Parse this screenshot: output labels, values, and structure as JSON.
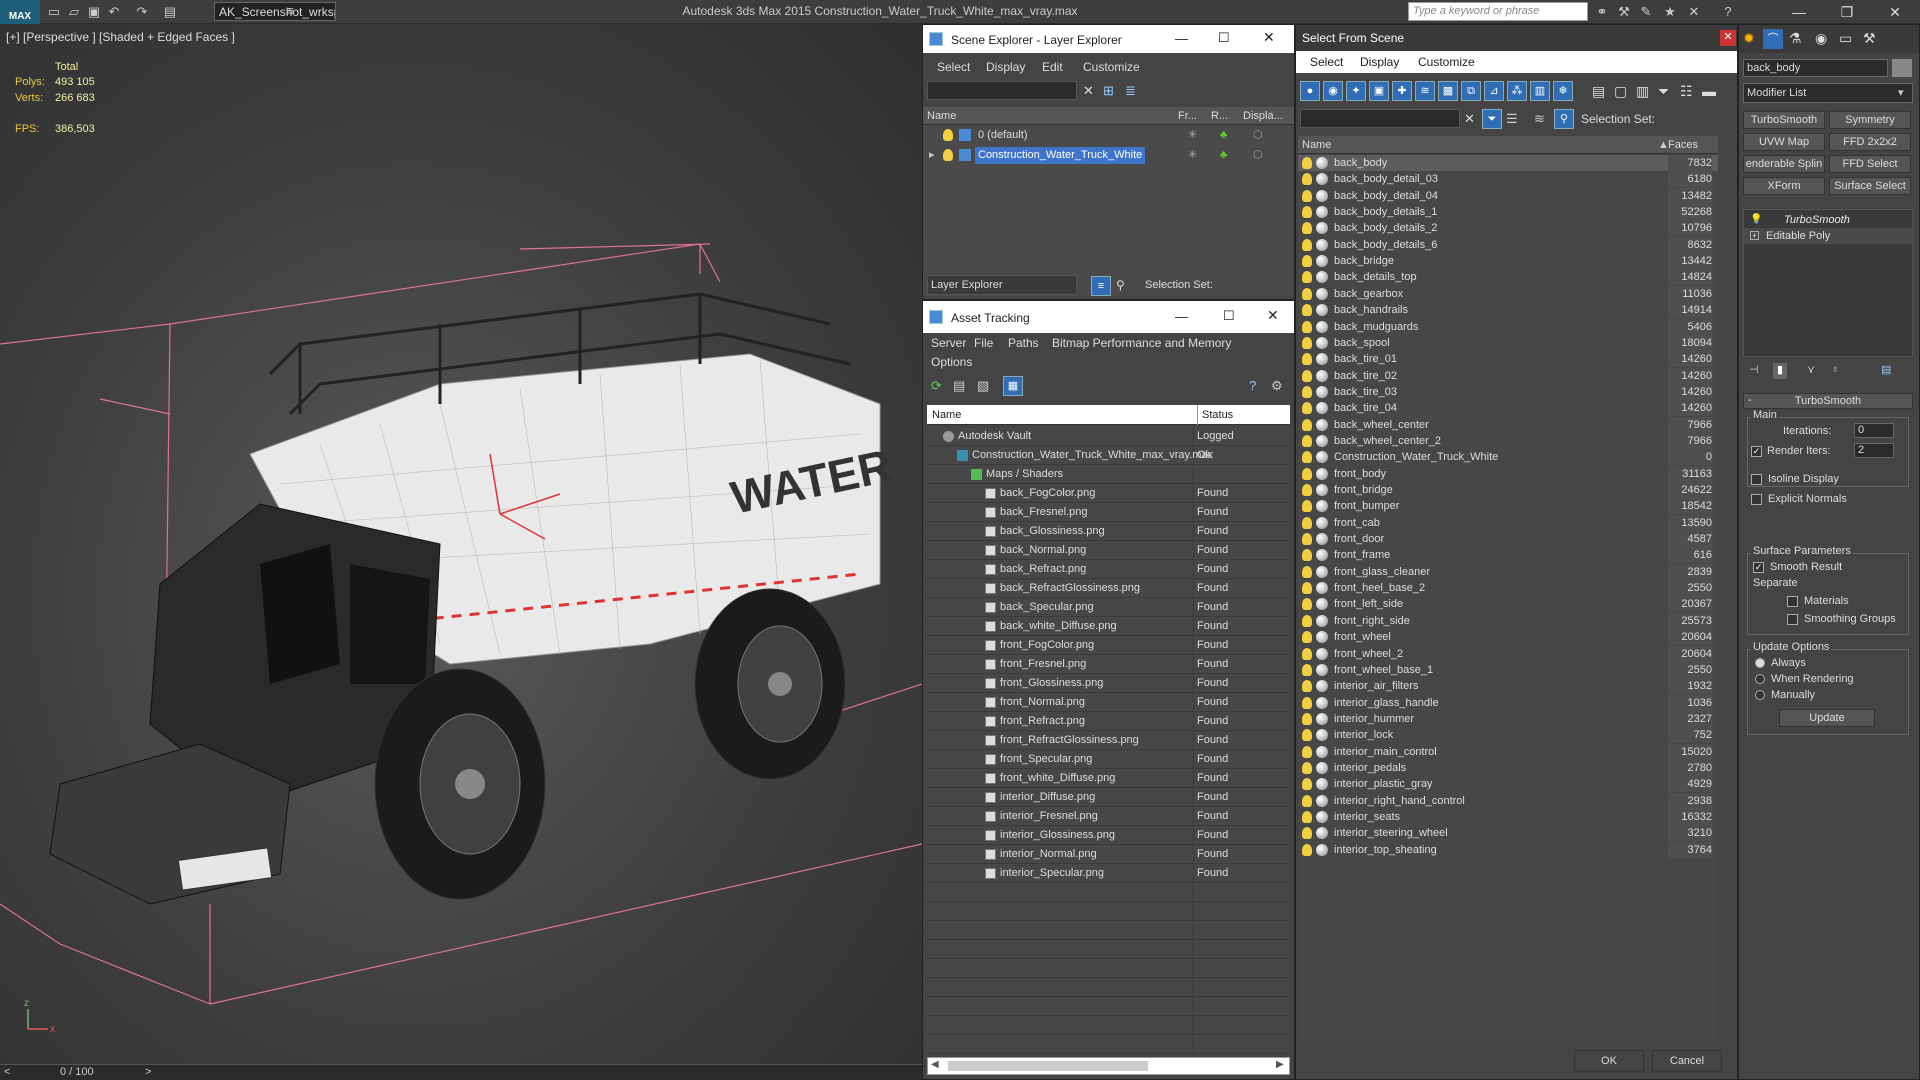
{
  "app": {
    "logo": "MAX",
    "workspace": "AK_Screenshot_wrksp",
    "title": "Autodesk 3ds Max  2015    Construction_Water_Truck_White_max_vray.max",
    "search_placeholder": "Type a keyword or phrase"
  },
  "viewport": {
    "label": "[+] [Perspective ] [Shaded + Edged Faces ]",
    "stats": {
      "total_label": "Total",
      "polys_label": "Polys:",
      "polys": "493 105",
      "verts_label": "Verts:",
      "verts": "266 683",
      "fps_label": "FPS:",
      "fps": "386,503"
    },
    "truck_text": "WATER",
    "axis_z": "z",
    "axis_x": "x",
    "timeline": {
      "prev": "<",
      "value": "0 / 100",
      "next": ">"
    }
  },
  "scene_explorer": {
    "title": "Scene Explorer - Layer Explorer",
    "menu": [
      "Select",
      "Display",
      "Edit",
      "Customize"
    ],
    "columns": {
      "name": "Name",
      "frozen": "Fr...",
      "render": "R...",
      "display": "Displa..."
    },
    "layers": [
      {
        "name": "0 (default)",
        "selected": false
      },
      {
        "name": "Construction_Water_Truck_White",
        "selected": true
      }
    ],
    "footer_dropdown": "Layer Explorer",
    "selection_set_label": "Selection Set:"
  },
  "asset_tracking": {
    "title": "Asset Tracking",
    "menu": [
      "Server",
      "File",
      "Paths",
      "Bitmap Performance and Memory"
    ],
    "menu2": "Options",
    "columns": {
      "name": "Name",
      "status": "Status"
    },
    "rows": [
      {
        "name": "Autodesk Vault",
        "status": "Logged",
        "level": 0,
        "icon": "vault"
      },
      {
        "name": "Construction_Water_Truck_White_max_vray.max",
        "status": "Ok",
        "level": 1,
        "icon": "max"
      },
      {
        "name": "Maps / Shaders",
        "status": "",
        "level": 2,
        "icon": "folder"
      },
      {
        "name": "back_FogColor.png",
        "status": "Found",
        "level": 3,
        "icon": "file"
      },
      {
        "name": "back_Fresnel.png",
        "status": "Found",
        "level": 3,
        "icon": "file"
      },
      {
        "name": "back_Glossiness.png",
        "status": "Found",
        "level": 3,
        "icon": "file"
      },
      {
        "name": "back_Normal.png",
        "status": "Found",
        "level": 3,
        "icon": "file"
      },
      {
        "name": "back_Refract.png",
        "status": "Found",
        "level": 3,
        "icon": "file"
      },
      {
        "name": "back_RefractGlossiness.png",
        "status": "Found",
        "level": 3,
        "icon": "file"
      },
      {
        "name": "back_Specular.png",
        "status": "Found",
        "level": 3,
        "icon": "file"
      },
      {
        "name": "back_white_Diffuse.png",
        "status": "Found",
        "level": 3,
        "icon": "file"
      },
      {
        "name": "front_FogColor.png",
        "status": "Found",
        "level": 3,
        "icon": "file"
      },
      {
        "name": "front_Fresnel.png",
        "status": "Found",
        "level": 3,
        "icon": "file"
      },
      {
        "name": "front_Glossiness.png",
        "status": "Found",
        "level": 3,
        "icon": "file"
      },
      {
        "name": "front_Normal.png",
        "status": "Found",
        "level": 3,
        "icon": "file"
      },
      {
        "name": "front_Refract.png",
        "status": "Found",
        "level": 3,
        "icon": "file"
      },
      {
        "name": "front_RefractGlossiness.png",
        "status": "Found",
        "level": 3,
        "icon": "file"
      },
      {
        "name": "front_Specular.png",
        "status": "Found",
        "level": 3,
        "icon": "file"
      },
      {
        "name": "front_white_Diffuse.png",
        "status": "Found",
        "level": 3,
        "icon": "file"
      },
      {
        "name": "interior_Diffuse.png",
        "status": "Found",
        "level": 3,
        "icon": "file"
      },
      {
        "name": "interior_Fresnel.png",
        "status": "Found",
        "level": 3,
        "icon": "file"
      },
      {
        "name": "interior_Glossiness.png",
        "status": "Found",
        "level": 3,
        "icon": "file"
      },
      {
        "name": "interior_Normal.png",
        "status": "Found",
        "level": 3,
        "icon": "file"
      },
      {
        "name": "interior_Specular.png",
        "status": "Found",
        "level": 3,
        "icon": "file"
      }
    ]
  },
  "select_from_scene": {
    "title": "Select From Scene",
    "menu": [
      "Select",
      "Display",
      "Customize"
    ],
    "selection_set_label": "Selection Set:",
    "columns": {
      "name": "Name",
      "faces": "Faces"
    },
    "objects": [
      {
        "name": "back_body",
        "faces": "7832",
        "selected": true
      },
      {
        "name": "back_body_detail_03",
        "faces": "6180"
      },
      {
        "name": "back_body_detail_04",
        "faces": "13482"
      },
      {
        "name": "back_body_details_1",
        "faces": "52268"
      },
      {
        "name": "back_body_details_2",
        "faces": "10796"
      },
      {
        "name": "back_body_details_6",
        "faces": "8632"
      },
      {
        "name": "back_bridge",
        "faces": "13442"
      },
      {
        "name": "back_details_top",
        "faces": "14824"
      },
      {
        "name": "back_gearbox",
        "faces": "11036"
      },
      {
        "name": "back_handrails",
        "faces": "14914"
      },
      {
        "name": "back_mudguards",
        "faces": "5406"
      },
      {
        "name": "back_spool",
        "faces": "18094"
      },
      {
        "name": "back_tire_01",
        "faces": "14260"
      },
      {
        "name": "back_tire_02",
        "faces": "14260"
      },
      {
        "name": "back_tire_03",
        "faces": "14260"
      },
      {
        "name": "back_tire_04",
        "faces": "14260"
      },
      {
        "name": "back_wheel_center",
        "faces": "7966"
      },
      {
        "name": "back_wheel_center_2",
        "faces": "7966"
      },
      {
        "name": "Construction_Water_Truck_White",
        "faces": "0",
        "group": true
      },
      {
        "name": "front_body",
        "faces": "31163"
      },
      {
        "name": "front_bridge",
        "faces": "24622"
      },
      {
        "name": "front_bumper",
        "faces": "18542"
      },
      {
        "name": "front_cab",
        "faces": "13590"
      },
      {
        "name": "front_door",
        "faces": "4587"
      },
      {
        "name": "front_frame",
        "faces": "616"
      },
      {
        "name": "front_glass_cleaner",
        "faces": "2839"
      },
      {
        "name": "front_heel_base_2",
        "faces": "2550"
      },
      {
        "name": "front_left_side",
        "faces": "20367"
      },
      {
        "name": "front_right_side",
        "faces": "25573"
      },
      {
        "name": "front_wheel",
        "faces": "20604"
      },
      {
        "name": "front_wheel_2",
        "faces": "20604"
      },
      {
        "name": "front_wheel_base_1",
        "faces": "2550"
      },
      {
        "name": "interior_air_filters",
        "faces": "1932"
      },
      {
        "name": "interior_glass_handle",
        "faces": "1036"
      },
      {
        "name": "interior_hummer",
        "faces": "2327"
      },
      {
        "name": "interior_lock",
        "faces": "752"
      },
      {
        "name": "interior_main_control",
        "faces": "15020"
      },
      {
        "name": "interior_pedals",
        "faces": "2780"
      },
      {
        "name": "interior_plastic_gray",
        "faces": "4929"
      },
      {
        "name": "interior_right_hand_control",
        "faces": "2938"
      },
      {
        "name": "interior_seats",
        "faces": "16332"
      },
      {
        "name": "interior_steering_wheel",
        "faces": "3210"
      },
      {
        "name": "interior_top_sheating",
        "faces": "3764"
      }
    ],
    "ok_label": "OK",
    "cancel_label": "Cancel"
  },
  "command_panel": {
    "object_name": "back_body",
    "modifier_list": "Modifier List",
    "modifier_buttons": [
      "TurboSmooth",
      "Symmetry",
      "UVW Map",
      "FFD 2x2x2",
      "enderable Splin",
      "FFD Select",
      "XForm",
      "Surface Select"
    ],
    "stack": [
      "TurboSmooth",
      "Editable Poly"
    ],
    "rollout_title": "TurboSmooth",
    "main_label": "Main",
    "iterations_label": "Iterations:",
    "iterations": "0",
    "render_iters_label": "Render Iters:",
    "render_iters": "2",
    "isoline_label": "Isoline Display",
    "explicit_normals_label": "Explicit Normals",
    "surface_params_label": "Surface Parameters",
    "smooth_result_label": "Smooth Result",
    "separate_label": "Separate",
    "materials_label": "Materials",
    "smoothing_groups_label": "Smoothing Groups",
    "update_options_label": "Update Options",
    "always_label": "Always",
    "when_rendering_label": "When Rendering",
    "manually_label": "Manually",
    "update_label": "Update"
  },
  "colors": {
    "selection_blue": "#3e74c9",
    "found_text": "#dddddd",
    "stats_yellow": "#e8c840",
    "bbox_pink": "#e0709a"
  }
}
